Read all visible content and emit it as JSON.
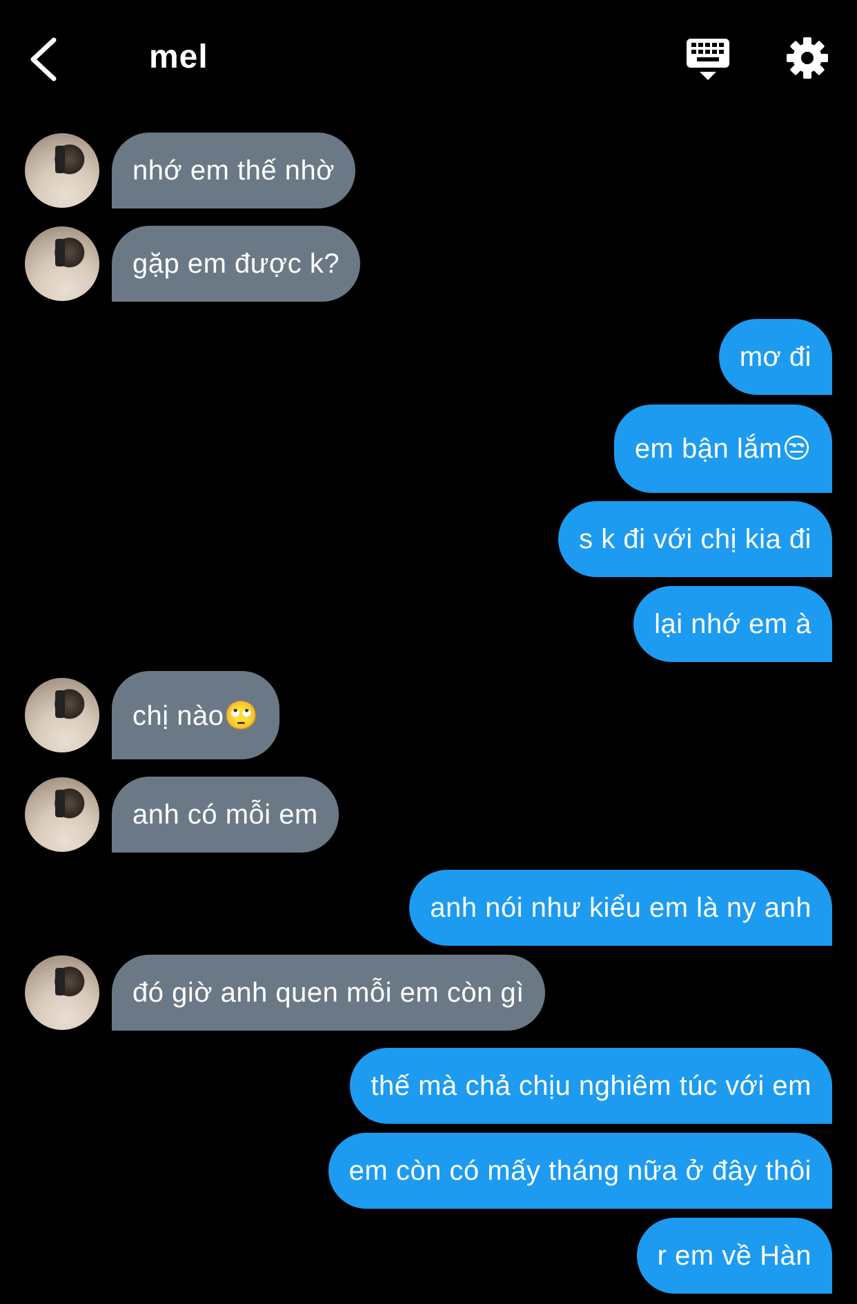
{
  "header": {
    "title": "mel"
  },
  "messages": [
    {
      "dir": "in",
      "text": "nhớ em thế nhờ"
    },
    {
      "dir": "in",
      "text": "gặp em được k?"
    },
    {
      "dir": "out",
      "text": "mơ đi"
    },
    {
      "dir": "out",
      "text": "em bận lắm😒"
    },
    {
      "dir": "out",
      "text": "s k đi với chị kia đi"
    },
    {
      "dir": "out",
      "text": "lại nhớ em à"
    },
    {
      "dir": "in",
      "text": "chị nào🙄"
    },
    {
      "dir": "in",
      "text": "anh có mỗi em"
    },
    {
      "dir": "out",
      "text": "anh nói như kiểu em là ny anh"
    },
    {
      "dir": "in",
      "text": "đó giờ anh quen mỗi em còn gì"
    },
    {
      "dir": "out",
      "text": "thế mà chả chịu nghiêm túc với em"
    },
    {
      "dir": "out",
      "text": "em còn có mấy tháng nữa ở đây thôi"
    },
    {
      "dir": "out",
      "text": "r em về Hàn"
    }
  ],
  "colors": {
    "background": "#000000",
    "incoming_bubble": "#6b7986",
    "outgoing_bubble": "#1d9bf0"
  },
  "icons": [
    "back-chevron-icon",
    "keyboard-icon",
    "gear-icon"
  ]
}
